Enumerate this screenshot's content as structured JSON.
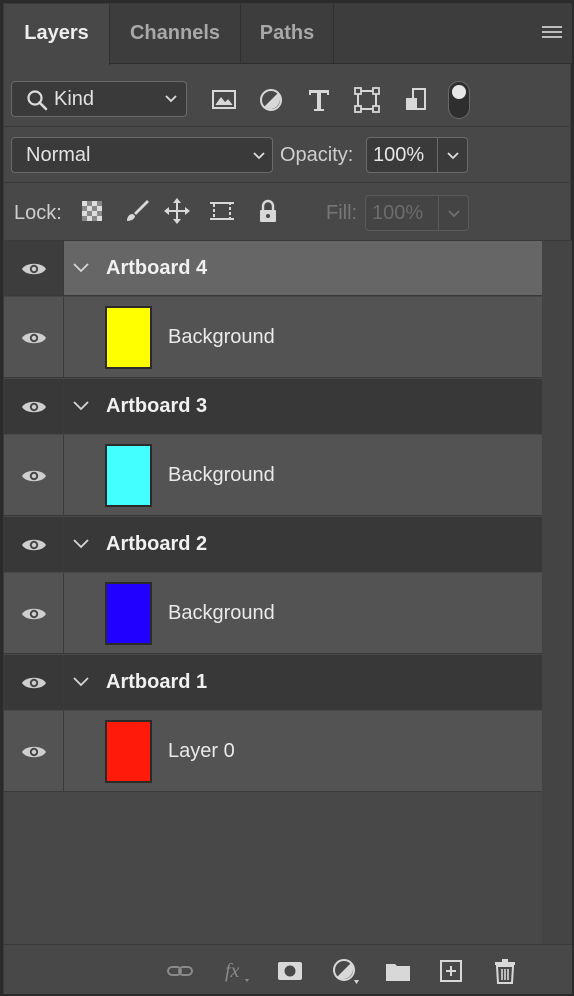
{
  "tabs": [
    {
      "label": "Layers"
    },
    {
      "label": "Channels"
    },
    {
      "label": "Paths"
    }
  ],
  "filter": {
    "kind_label": "Kind",
    "icons": [
      "image-filter-icon",
      "adjustment-filter-icon",
      "type-filter-icon",
      "shape-filter-icon",
      "smart-object-filter-icon"
    ]
  },
  "blend_mode": {
    "value": "Normal"
  },
  "opacity": {
    "label": "Opacity:",
    "value": "100%"
  },
  "lock": {
    "label": "Lock:",
    "icons": [
      "lock-transparent-icon",
      "lock-image-icon",
      "lock-position-icon",
      "lock-artboard-icon",
      "lock-all-icon"
    ]
  },
  "fill": {
    "label": "Fill:",
    "value": "100%"
  },
  "layers": [
    {
      "type": "artboard",
      "name": "Artboard 4",
      "selected": true
    },
    {
      "type": "layer",
      "name": "Background",
      "color": "#ffff00"
    },
    {
      "type": "artboard",
      "name": "Artboard 3",
      "selected": false
    },
    {
      "type": "layer",
      "name": "Background",
      "color": "#44ffff"
    },
    {
      "type": "artboard",
      "name": "Artboard 2",
      "selected": false
    },
    {
      "type": "layer",
      "name": "Background",
      "color": "#2200ff"
    },
    {
      "type": "artboard",
      "name": "Artboard 1",
      "selected": false
    },
    {
      "type": "layer",
      "name": "Layer 0",
      "color": "#ff1a0a"
    }
  ],
  "footer_icons": [
    "link-layers-icon",
    "fx-icon",
    "add-mask-icon",
    "adjustment-layer-icon",
    "new-group-icon",
    "new-layer-icon",
    "delete-icon"
  ]
}
